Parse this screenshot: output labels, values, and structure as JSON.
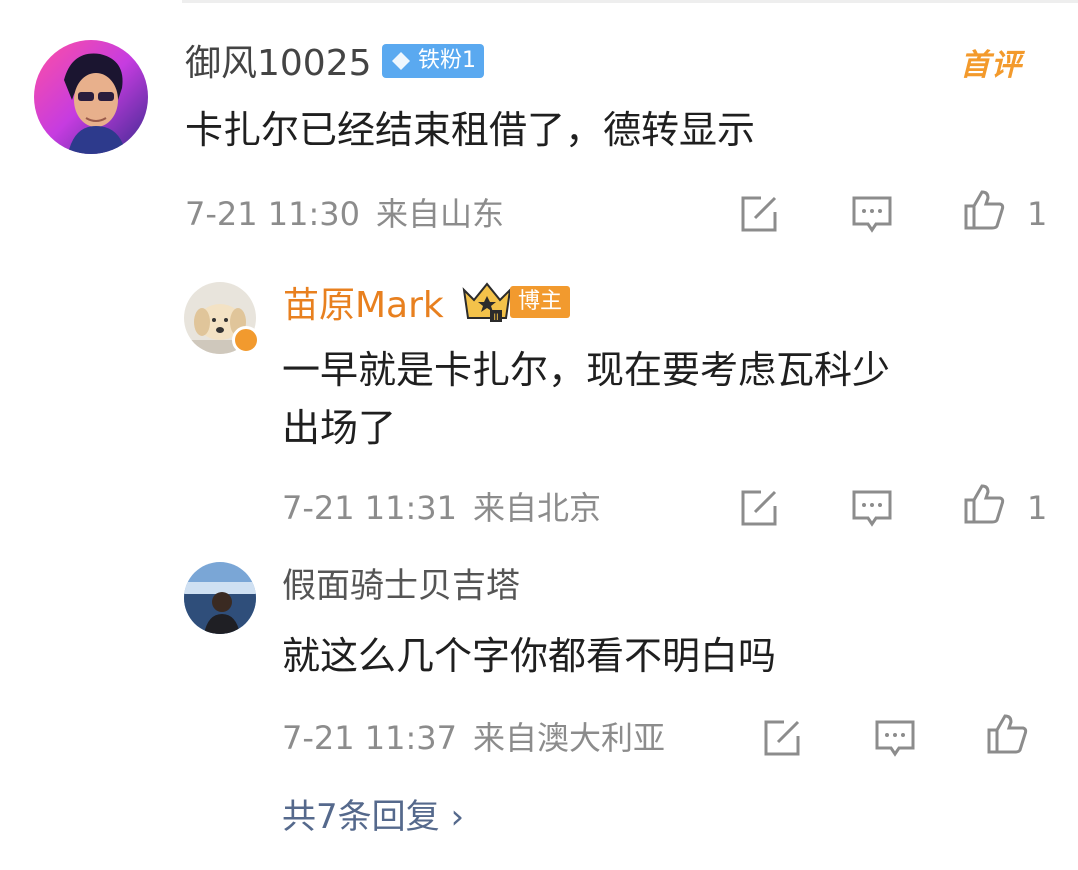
{
  "comment": {
    "username": "御风10025",
    "fan_badge": "铁粉1",
    "first_comment_tag": "首评",
    "text": "卡扎尔已经结束租借了，德转显示",
    "time": "7-21 11:30",
    "location": "来自山东",
    "like_count": "1"
  },
  "replies": [
    {
      "username": "苗原Mark",
      "badge": "博主",
      "text_line1": "一早就是卡扎尔，现在要考虑瓦科少",
      "text_line2": "出场了",
      "time": "7-21 11:31",
      "location": "来自北京",
      "like_count": "1"
    },
    {
      "username": "假面骑士贝吉塔",
      "text": "就这么几个字你都看不明白吗",
      "time": "7-21 11:37",
      "location": "来自澳大利亚"
    }
  ],
  "more_replies": "共7条回复 ›",
  "icons": {
    "share": "share-icon",
    "comment": "comment-icon",
    "like": "like-icon",
    "fan_diamond": "diamond-icon",
    "crown": "crown-icon",
    "verify": "verified-icon"
  },
  "colors": {
    "blogger_orange": "#e8801f",
    "fan_badge_blue": "#5aa9f0",
    "meta_gray": "#8c8c8c",
    "link_blue": "#55698c"
  }
}
